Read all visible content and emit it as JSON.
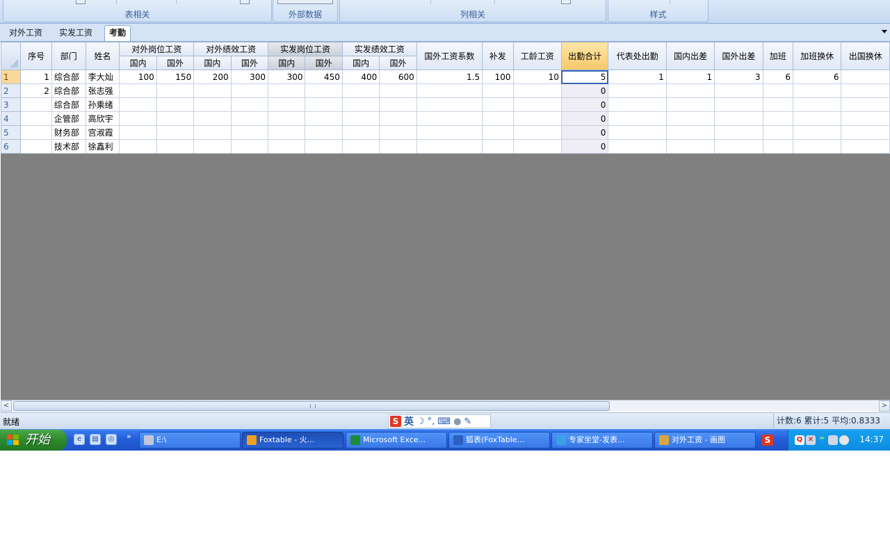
{
  "ribbon": {
    "groups": [
      {
        "label": "表相关"
      },
      {
        "label": "外部数据"
      },
      {
        "label": "列相关"
      },
      {
        "label": "样式"
      }
    ]
  },
  "sheet_tabs": [
    {
      "label": "对外工资",
      "active": false
    },
    {
      "label": "实发工资",
      "active": false
    },
    {
      "label": "考勤",
      "active": true
    }
  ],
  "grid": {
    "headers": {
      "seq": "序号",
      "dept": "部门",
      "name": "姓名",
      "group1": "对外岗位工资",
      "group2": "对外绩效工资",
      "group3": "实发岗位工资",
      "group4": "实发绩效工资",
      "domestic": "国内",
      "foreign": "国外",
      "coef": "国外工资系数",
      "subsidy": "补发",
      "seniority": "工龄工资",
      "attendance": "出勤合计",
      "office": "代表处出勤",
      "trip_dom": "国内出差",
      "trip_for": "国外出差",
      "overtime": "加班",
      "ot_rest": "加班换休",
      "abroad_rest": "出国换休"
    },
    "rows": [
      {
        "rownum": "1",
        "seq": "1",
        "dept": "综合部",
        "name": "李大灿",
        "g1d": "100",
        "g1f": "150",
        "g2d": "200",
        "g2f": "300",
        "g3d": "300",
        "g3f": "450",
        "g4d": "400",
        "g4f": "600",
        "coef": "1.5",
        "subsidy": "100",
        "seniority": "10",
        "attendance": "5",
        "office": "1",
        "trip_dom": "1",
        "trip_for": "3",
        "overtime": "6",
        "ot_rest": "6",
        "abroad_rest": ""
      },
      {
        "rownum": "2",
        "seq": "2",
        "dept": "综合部",
        "name": "张志强",
        "g1d": "",
        "g1f": "",
        "g2d": "",
        "g2f": "",
        "g3d": "",
        "g3f": "",
        "g4d": "",
        "g4f": "",
        "coef": "",
        "subsidy": "",
        "seniority": "",
        "attendance": "0",
        "office": "",
        "trip_dom": "",
        "trip_for": "",
        "overtime": "",
        "ot_rest": "",
        "abroad_rest": ""
      },
      {
        "rownum": "3",
        "seq": "",
        "dept": "综合部",
        "name": "孙乘绪",
        "g1d": "",
        "g1f": "",
        "g2d": "",
        "g2f": "",
        "g3d": "",
        "g3f": "",
        "g4d": "",
        "g4f": "",
        "coef": "",
        "subsidy": "",
        "seniority": "",
        "attendance": "0",
        "office": "",
        "trip_dom": "",
        "trip_for": "",
        "overtime": "",
        "ot_rest": "",
        "abroad_rest": ""
      },
      {
        "rownum": "4",
        "seq": "",
        "dept": "企管部",
        "name": "高欣宇",
        "g1d": "",
        "g1f": "",
        "g2d": "",
        "g2f": "",
        "g3d": "",
        "g3f": "",
        "g4d": "",
        "g4f": "",
        "coef": "",
        "subsidy": "",
        "seniority": "",
        "attendance": "0",
        "office": "",
        "trip_dom": "",
        "trip_for": "",
        "overtime": "",
        "ot_rest": "",
        "abroad_rest": ""
      },
      {
        "rownum": "5",
        "seq": "",
        "dept": "财务部",
        "name": "宫淑霞",
        "g1d": "",
        "g1f": "",
        "g2d": "",
        "g2f": "",
        "g3d": "",
        "g3f": "",
        "g4d": "",
        "g4f": "",
        "coef": "",
        "subsidy": "",
        "seniority": "",
        "attendance": "0",
        "office": "",
        "trip_dom": "",
        "trip_for": "",
        "overtime": "",
        "ot_rest": "",
        "abroad_rest": ""
      },
      {
        "rownum": "6",
        "seq": "",
        "dept": "技术部",
        "name": "徐鑫利",
        "g1d": "",
        "g1f": "",
        "g2d": "",
        "g2f": "",
        "g3d": "",
        "g3f": "",
        "g4d": "",
        "g4f": "",
        "coef": "",
        "subsidy": "",
        "seniority": "",
        "attendance": "0",
        "office": "",
        "trip_dom": "",
        "trip_for": "",
        "overtime": "",
        "ot_rest": "",
        "abroad_rest": ""
      }
    ]
  },
  "status": {
    "ready": "就绪",
    "ime_lang": "英",
    "ime_logo": "S",
    "stats": "计数:6 累计:5 平均:0.8333"
  },
  "taskbar": {
    "start": "开始",
    "quick_more": "»",
    "buttons": [
      {
        "label": "E:\\",
        "icon": "drive-icon",
        "color": "#c0c8d8"
      },
      {
        "label": "Foxtable - 火...",
        "icon": "foxtable-icon",
        "color": "#f0a020"
      },
      {
        "label": "Microsoft Exce...",
        "icon": "excel-icon",
        "color": "#1e8a3c"
      },
      {
        "label": "狐表(FoxTable...",
        "icon": "word-icon",
        "color": "#2b5fc0"
      },
      {
        "label": "专家坐堂-发表...",
        "icon": "ie-icon",
        "color": "#3aa0e8"
      },
      {
        "label": "对外工资 - 画图",
        "icon": "paint-icon",
        "color": "#d9a640"
      }
    ],
    "clock": "14:37"
  }
}
